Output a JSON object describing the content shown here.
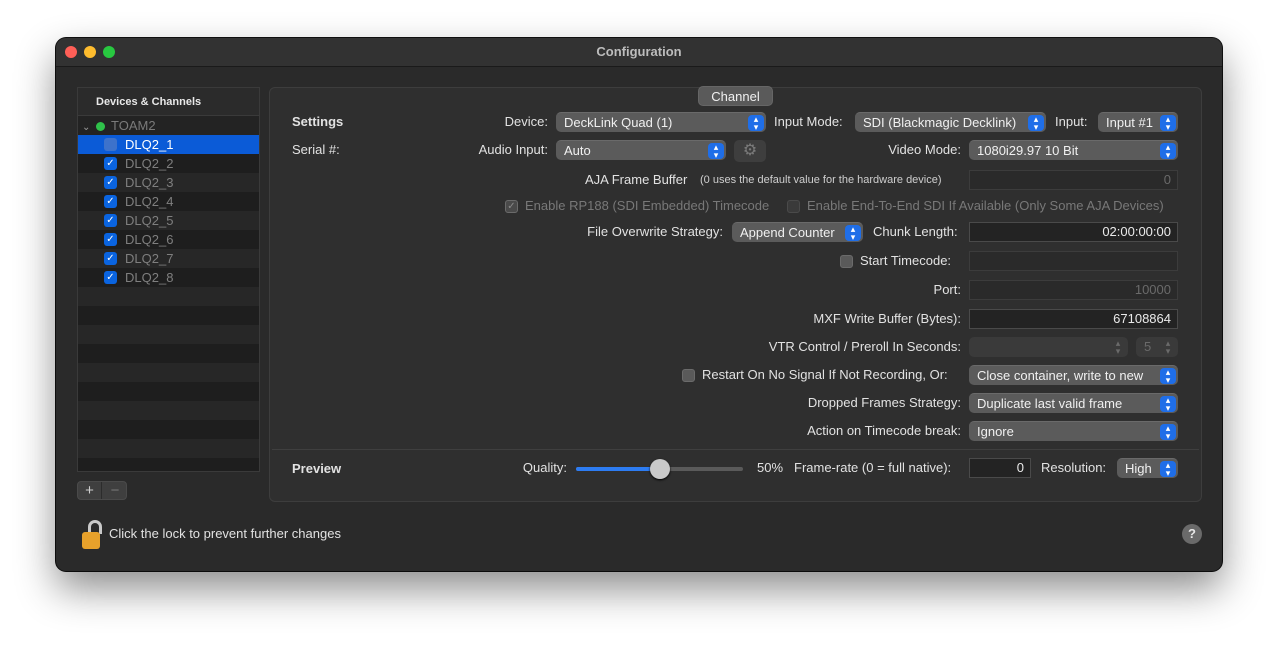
{
  "window": {
    "title": "Configuration"
  },
  "sidebar": {
    "header": "Devices & Channels",
    "group": {
      "label": "TOAM2",
      "status_color": "#2fc14a"
    },
    "items": [
      {
        "label": "DLQ2_1",
        "checked": false,
        "selected": true
      },
      {
        "label": "DLQ2_2",
        "checked": true
      },
      {
        "label": "DLQ2_3",
        "checked": true
      },
      {
        "label": "DLQ2_4",
        "checked": true
      },
      {
        "label": "DLQ2_5",
        "checked": true
      },
      {
        "label": "DLQ2_6",
        "checked": true
      },
      {
        "label": "DLQ2_7",
        "checked": true
      },
      {
        "label": "DLQ2_8",
        "checked": true
      }
    ],
    "add_label": "+",
    "remove_label": "−"
  },
  "tab": {
    "label": "Channel"
  },
  "settings": {
    "section_label": "Settings",
    "device_label": "Device:",
    "device_value": "DeckLink Quad (1)",
    "input_mode_label": "Input Mode:",
    "input_mode_value": "SDI (Blackmagic Decklink)",
    "input_label": "Input:",
    "input_value": "Input #1",
    "serial_label": "Serial #:",
    "audio_input_label": "Audio Input:",
    "audio_input_value": "Auto",
    "video_mode_label": "Video Mode:",
    "video_mode_value": "1080i29.97 10 Bit",
    "aja_label": "AJA Frame Buffer",
    "aja_hint": "(0 uses the default value for the hardware device)",
    "aja_value": "0",
    "rp188_label": "Enable RP188 (SDI Embedded) Timecode",
    "e2e_label": "Enable End-To-End SDI If Available (Only Some AJA Devices)",
    "overwrite_label": "File Overwrite Strategy:",
    "overwrite_value": "Append Counter",
    "chunk_label": "Chunk Length:",
    "chunk_value": "02:00:00:00",
    "start_tc_label": "Start Timecode:",
    "start_tc_value": "",
    "port_label": "Port:",
    "port_value": "10000",
    "mxf_label": "MXF Write Buffer (Bytes):",
    "mxf_value": "67108864",
    "vtr_label": "VTR Control / Preroll In Seconds:",
    "vtr_value": "",
    "vtr_seconds": "5",
    "restart_label": "Restart On No Signal If Not Recording, Or:",
    "restart_value": "Close container, write to new",
    "dropped_label": "Dropped Frames Strategy:",
    "dropped_value": "Duplicate last valid frame",
    "tc_break_label": "Action on Timecode break:",
    "tc_break_value": "Ignore"
  },
  "preview": {
    "section_label": "Preview",
    "quality_label": "Quality:",
    "quality_fraction": 0.5,
    "quality_text": "50%",
    "framerate_label": "Frame-rate (0 = full native):",
    "framerate_value": "0",
    "resolution_label": "Resolution:",
    "resolution_value": "High"
  },
  "footer": {
    "lock_text": "Click the lock to prevent further changes",
    "help_label": "?"
  }
}
